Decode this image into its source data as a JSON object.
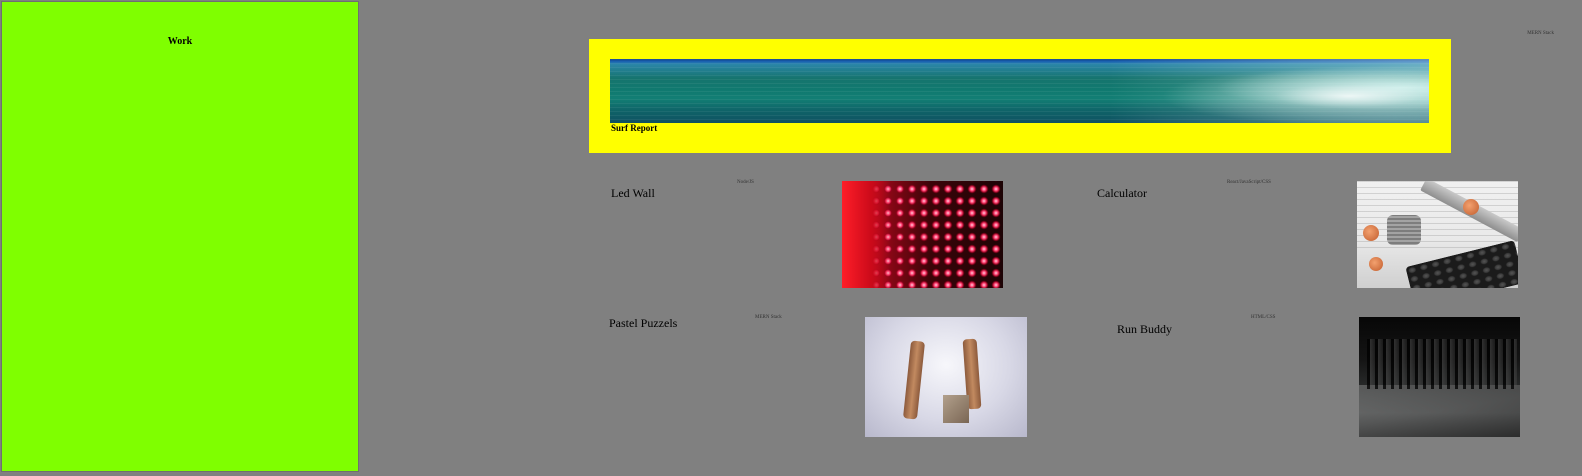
{
  "sidebar": {
    "title": "Work",
    "background_color": "#7fff00"
  },
  "header": {
    "tag": "MERN Stack"
  },
  "featured": {
    "label": "Surf Report",
    "image": "ocean-waves-image",
    "frame_color": "#ffff00"
  },
  "projects": [
    {
      "title": "Led Wall",
      "tag": "Node/JS",
      "image": "led-wall-image"
    },
    {
      "title": "Calculator",
      "tag": "React/JavaScript/CSS",
      "image": "calculator-coins-image"
    },
    {
      "title": "Pastel Puzzels",
      "tag": "MERN Stack",
      "image": "wooden-figures-puzzle-image"
    },
    {
      "title": "Run Buddy",
      "tag": "HTML/CSS",
      "image": "runners-street-image"
    }
  ],
  "colors": {
    "page_background": "#808080",
    "sidebar": "#7fff00",
    "featured_frame": "#ffff00"
  }
}
